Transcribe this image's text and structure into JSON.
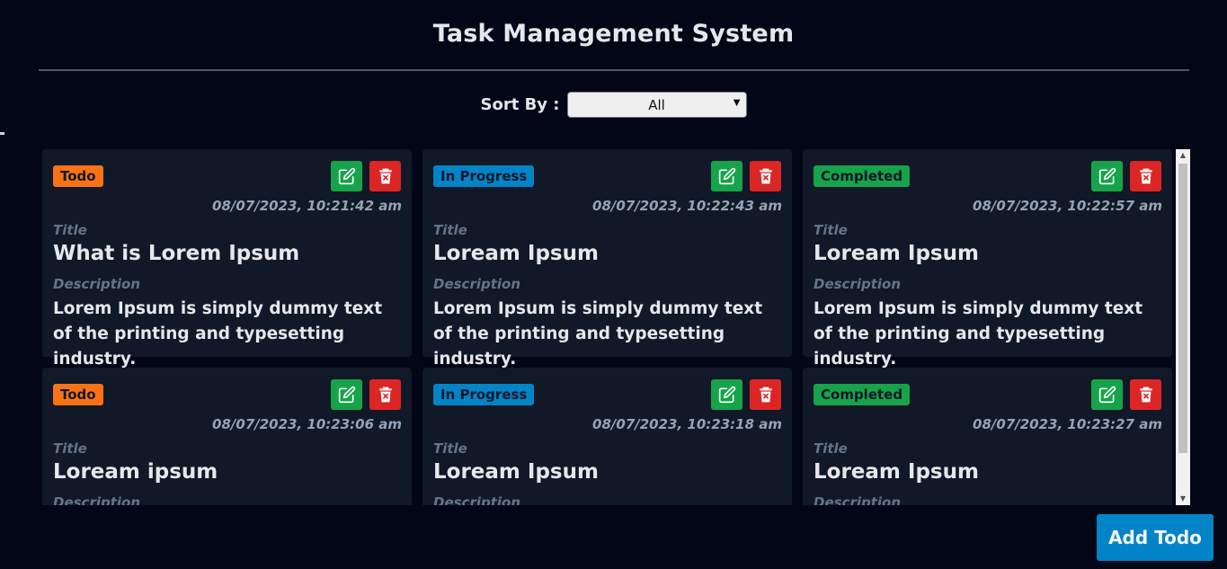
{
  "header": {
    "title": "Task Management System"
  },
  "sort": {
    "label": "Sort By :",
    "selected": "All"
  },
  "labels": {
    "title": "Title",
    "description": "Description"
  },
  "tasks": [
    {
      "status": "Todo",
      "status_color": "#f97316",
      "status_text_color": "#111827",
      "timestamp": "08/07/2023, 10:21:42 am",
      "title": "What is Lorem Ipsum",
      "description": "Lorem Ipsum is simply dummy text of the printing and typesetting industry."
    },
    {
      "status": "In Progress",
      "status_color": "#0284c7",
      "status_text_color": "#0f172a",
      "timestamp": "08/07/2023, 10:22:43 am",
      "title": "Loream Ipsum",
      "description": "Lorem Ipsum is simply dummy text of the printing and typesetting industry."
    },
    {
      "status": "Completed",
      "status_color": "#16a34a",
      "status_text_color": "#0f172a",
      "timestamp": "08/07/2023, 10:22:57 am",
      "title": "Loream Ipsum",
      "description": "Lorem Ipsum is simply dummy text of the printing and typesetting industry."
    },
    {
      "status": "Todo",
      "status_color": "#f97316",
      "status_text_color": "#111827",
      "timestamp": "08/07/2023, 10:23:06 am",
      "title": "Loream ipsum",
      "description": ""
    },
    {
      "status": "In Progress",
      "status_color": "#0284c7",
      "status_text_color": "#0f172a",
      "timestamp": "08/07/2023, 10:23:18 am",
      "title": "Loream Ipsum",
      "description": ""
    },
    {
      "status": "Completed",
      "status_color": "#16a34a",
      "status_text_color": "#0f172a",
      "timestamp": "08/07/2023, 10:23:27 am",
      "title": "Loream Ipsum",
      "description": ""
    }
  ],
  "icons": {
    "edit": "edit-icon",
    "delete": "trash-icon"
  },
  "footer": {
    "add_button_label": "Add Todo"
  },
  "colors": {
    "background": "#020617",
    "card": "#111827",
    "edit": "#16a34a",
    "delete": "#dc2626",
    "accent": "#0284c7"
  }
}
